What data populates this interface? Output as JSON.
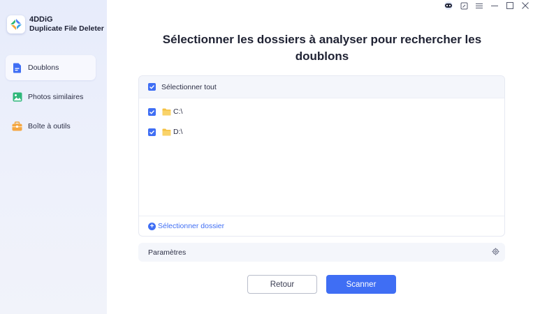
{
  "app": {
    "brand_name": "4DDiG",
    "brand_sub": "Duplicate File Deleter"
  },
  "sidebar": {
    "items": [
      {
        "label": "Doublons",
        "icon": "document-icon",
        "active": true
      },
      {
        "label": "Photos similaires",
        "icon": "image-icon",
        "active": false
      },
      {
        "label": "Boîte à outils",
        "icon": "toolbox-icon",
        "active": false
      }
    ]
  },
  "window_controls": [
    "assistant-icon",
    "feedback-icon",
    "menu-icon",
    "minimize-icon",
    "maximize-icon",
    "close-icon"
  ],
  "main": {
    "title": "Sélectionner les dossiers à analyser pour rechercher les doublons",
    "select_all_label": "Sélectionner tout",
    "drives": [
      {
        "label": "C:\\",
        "checked": true
      },
      {
        "label": "D:\\",
        "checked": true
      }
    ],
    "add_folder_label": "Sélectionner dossier",
    "settings_label": "Paramètres",
    "back_label": "Retour",
    "scan_label": "Scanner"
  },
  "colors": {
    "accent": "#3f6ef4",
    "sidebar_bg": "#e9edfb",
    "folder": "#f5c243"
  }
}
